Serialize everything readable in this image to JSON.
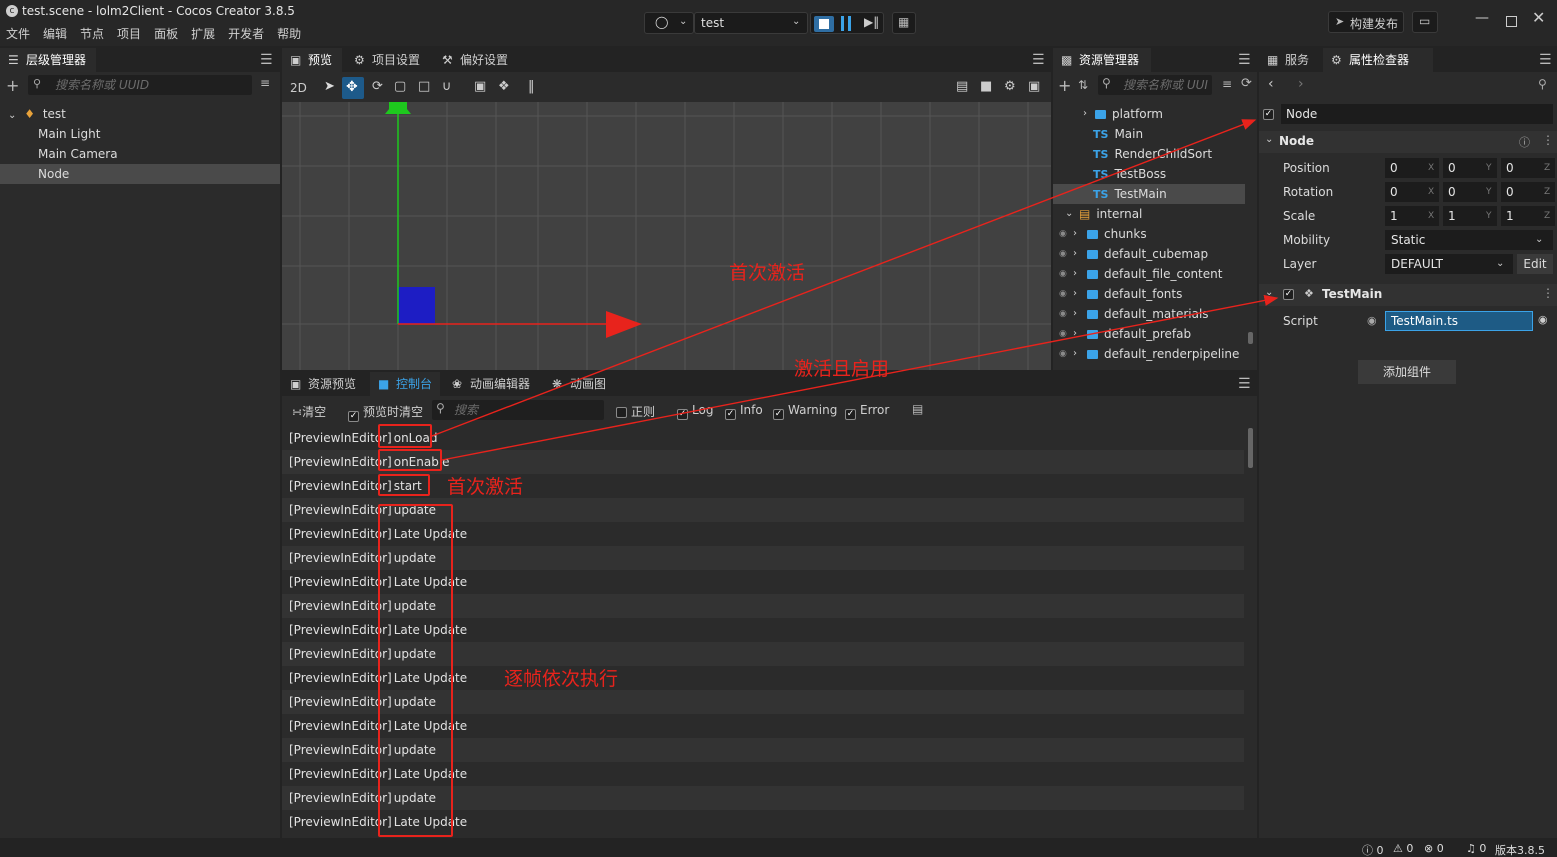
{
  "window": {
    "title": "test.scene - lolm2Client - Cocos Creator 3.8.5",
    "menu": [
      "文件",
      "编辑",
      "节点",
      "项目",
      "面板",
      "扩展",
      "开发者",
      "帮助"
    ],
    "scene_select": "test",
    "build_button": "构建发布"
  },
  "hierarchy": {
    "tab": "层级管理器",
    "search_placeholder": "搜索名称或 UUID",
    "root": "test",
    "children": [
      "Main Light",
      "Main Camera",
      "Node"
    ]
  },
  "scene": {
    "tabs": [
      "预览",
      "项目设置",
      "偏好设置"
    ],
    "mode_2d": "2D"
  },
  "assets": {
    "tab": "资源管理器",
    "search_placeholder": "搜索名称或 UUI",
    "items": [
      {
        "name": "platform",
        "kind": "folder"
      },
      {
        "name": "Main",
        "kind": "ts"
      },
      {
        "name": "RenderChildSort",
        "kind": "ts"
      },
      {
        "name": "TestBoss",
        "kind": "ts"
      },
      {
        "name": "TestMain",
        "kind": "ts"
      },
      {
        "name": "internal",
        "kind": "db"
      },
      {
        "name": "chunks",
        "kind": "folder"
      },
      {
        "name": "default_cubemap",
        "kind": "folder"
      },
      {
        "name": "default_file_content",
        "kind": "folder"
      },
      {
        "name": "default_fonts",
        "kind": "folder"
      },
      {
        "name": "default_materials",
        "kind": "folder"
      },
      {
        "name": "default_prefab",
        "kind": "folder"
      },
      {
        "name": "default_renderpipeline",
        "kind": "folder"
      }
    ]
  },
  "inspector": {
    "tabs": [
      "服务",
      "属性检查器"
    ],
    "node_name": "Node",
    "section": "Node",
    "position": {
      "label": "Position",
      "x": "0",
      "y": "0",
      "z": "0"
    },
    "rotation": {
      "label": "Rotation",
      "x": "0",
      "y": "0",
      "z": "0"
    },
    "scale": {
      "label": "Scale",
      "x": "1",
      "y": "1",
      "z": "1"
    },
    "axis_labels": [
      "X",
      "Y",
      "Z"
    ],
    "mobility": {
      "label": "Mobility",
      "value": "Static"
    },
    "layer": {
      "label": "Layer",
      "value": "DEFAULT",
      "edit": "Edit"
    },
    "component": "TestMain",
    "script": {
      "label": "Script",
      "value": "TestMain.ts"
    },
    "add_component": "添加组件"
  },
  "console": {
    "tabs": [
      "资源预览",
      "控制台",
      "动画编辑器",
      "动画图"
    ],
    "clear": "清空",
    "clear_on_preview": "预览时清空",
    "search_placeholder": "搜索",
    "filters": {
      "regex": "正则",
      "log": "Log",
      "info": "Info",
      "warning": "Warning",
      "error": "Error"
    },
    "prefix": "[PreviewInEditor]",
    "messages": [
      "onLoad",
      "onEnable",
      "start",
      "update",
      "Late Update",
      "update",
      "Late Update",
      "update",
      "Late Update",
      "update",
      "Late Update",
      "update",
      "Late Update",
      "update",
      "Late Update",
      "update",
      "Late Update"
    ]
  },
  "annotations": {
    "first_activate": "首次激活",
    "activate_enable": "激活且启用",
    "first_activate_console": "首次激活",
    "per_frame": "逐帧依次执行"
  },
  "statusbar": {
    "info_count": "0",
    "warn_count": "0",
    "error_count": "0",
    "notice_count": "0",
    "version": "版本3.8.5"
  },
  "colors": {
    "annotation": "#e8231c",
    "accent": "#3ba3e8",
    "gizmo_x": "#e8231c",
    "gizmo_y": "#1ec81e",
    "gizmo_z": "#1d1dc4"
  }
}
